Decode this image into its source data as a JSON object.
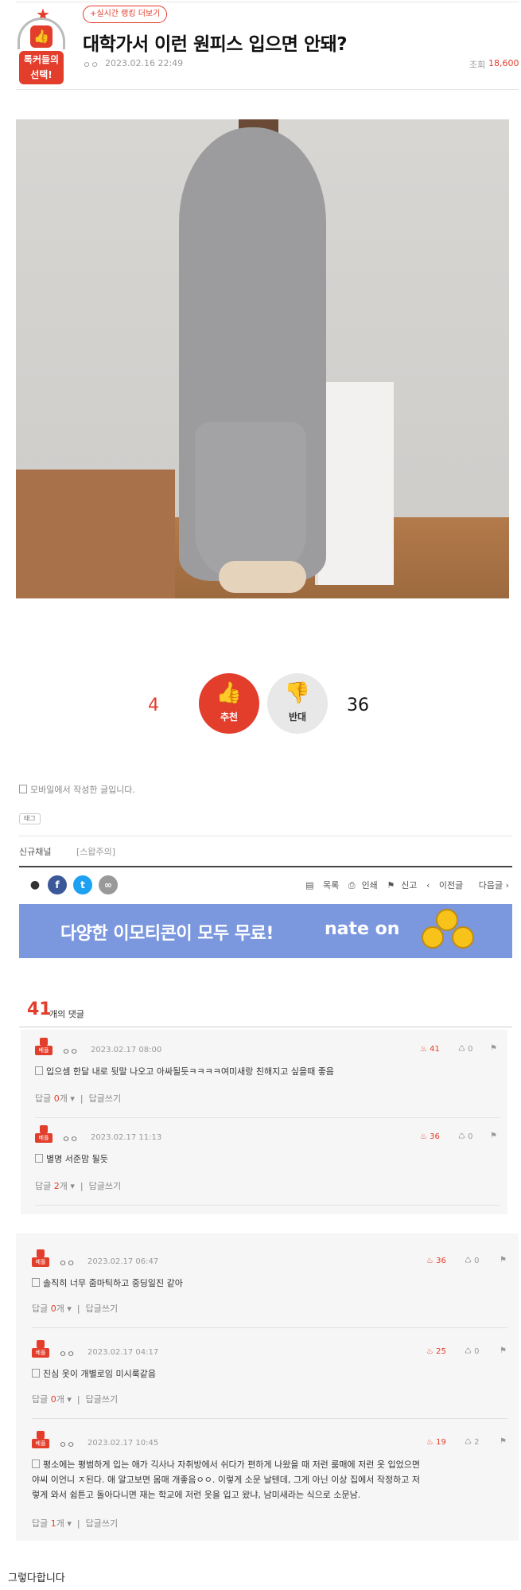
{
  "header": {
    "badge_label_top": "톡커들의",
    "badge_label_bottom": "선택!",
    "rank_link": "+실시간 랭킹 더보기",
    "title": "대학가서 이런 원피스 입으면 안돼?",
    "author": "ㅇㅇ",
    "date": "2023.02.16 22:49",
    "views_label": "조회",
    "views": "18,600"
  },
  "photo": {
    "icon": "photo-of-grey-dress"
  },
  "votes": {
    "up_count": "4",
    "up_label": "추천",
    "down_label": "반대",
    "down_count": "36"
  },
  "post_footer": {
    "mobile_note": "모바일에서 작성한 글입니다.",
    "tag_label": "태그",
    "channel_label": "신규채널",
    "channel_value": "[스왑주의]"
  },
  "share": {
    "list": "목록",
    "print": "인쇄",
    "report": "신고",
    "prev": "이전글",
    "next": "다음글"
  },
  "banner": {
    "text": "다양한 이모티콘이 모두 무료!",
    "brand": "nate on"
  },
  "comments": {
    "count": "41",
    "label": "개의 댓글",
    "badge": "베플",
    "reply_label": "답글",
    "reply_unit": "개",
    "write_label": "답글쓰기",
    "items": [
      {
        "author": "ㅇㅇ",
        "date": "2023.02.17 08:00",
        "likes": "41",
        "dislikes": "0",
        "text": "입으셈 한달 내로 뒷말 나오고 아싸될듯ㅋㅋㅋㅋ여미새랑 친해지고 싶을때 좋음",
        "replies": "0"
      },
      {
        "author": "ㅇㅇ",
        "date": "2023.02.17 11:13",
        "likes": "36",
        "dislikes": "0",
        "text": "별명 서준맘 될듯",
        "replies": "2"
      },
      {
        "author": "ㅇㅇ",
        "date": "2023.02.17 06:47",
        "likes": "36",
        "dislikes": "0",
        "text": "솔직히 너무 줌마틱하고 중딩일진 같아",
        "replies": "0"
      },
      {
        "author": "ㅇㅇ",
        "date": "2023.02.17 04:17",
        "likes": "25",
        "dislikes": "0",
        "text": "진심 옷이 개별로임 미시룩같음",
        "replies": "0"
      },
      {
        "author": "ㅇㅇ",
        "date": "2023.02.17 10:45",
        "likes": "19",
        "dislikes": "2",
        "text_lines": [
          "평소에는 평범하게 입는 애가 긱사나 자취방에서 쉬다가 편하게 나왔을 때 저런 룸매에 저런 옷 입었으면",
          "야씨 이언니 ㅈ된다. 애 알고보면 몸매 개좋음ㅇㅇ. 이렇게 소문 날텐데, 그게 아닌 이상 집에서 작정하고 저",
          "렇게 와서 쉼튼고 돌아다니면 재는 학교에 저런 옷을 입고 왔냐, 남미새라는 식으로 소문남."
        ],
        "replies": "1"
      }
    ]
  },
  "final_text": "그렇다합니다"
}
